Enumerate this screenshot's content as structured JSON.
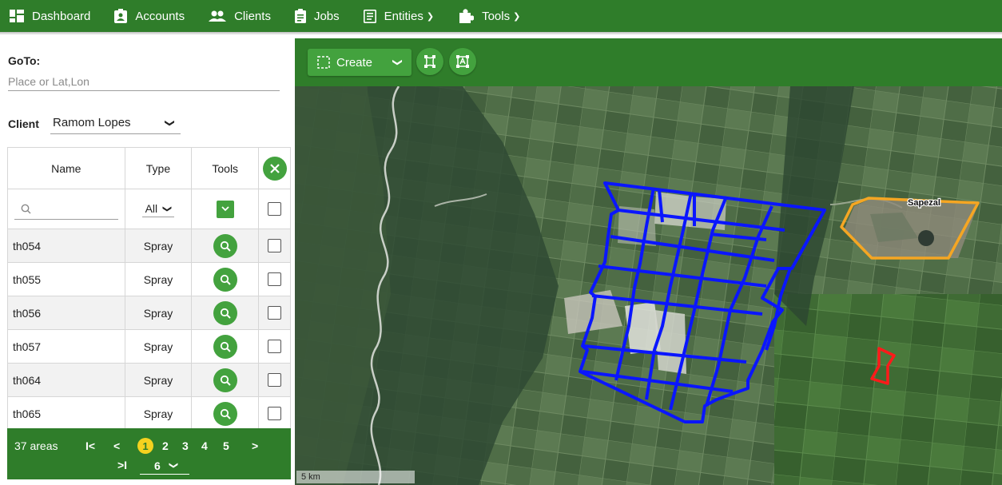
{
  "nav": [
    {
      "label": "Dashboard",
      "icon": "dashboard-icon"
    },
    {
      "label": "Accounts",
      "icon": "account-badge-icon"
    },
    {
      "label": "Clients",
      "icon": "people-icon"
    },
    {
      "label": "Jobs",
      "icon": "clipboard-icon"
    },
    {
      "label": "Entities",
      "icon": "list-icon",
      "dropdown": true
    },
    {
      "label": "Tools",
      "icon": "puzzle-icon",
      "dropdown": true
    }
  ],
  "goto": {
    "label": "GoTo:",
    "placeholder": "Place or Lat,Lon"
  },
  "client": {
    "label": "Client",
    "selected": "Ramom Lopes"
  },
  "table": {
    "headers": {
      "name": "Name",
      "type": "Type",
      "tools": "Tools"
    },
    "type_filter": "All",
    "rows": [
      {
        "name": "th054",
        "type": "Spray"
      },
      {
        "name": "th055",
        "type": "Spray"
      },
      {
        "name": "th056",
        "type": "Spray"
      },
      {
        "name": "th057",
        "type": "Spray"
      },
      {
        "name": "th064",
        "type": "Spray"
      },
      {
        "name": "th065",
        "type": "Spray"
      }
    ]
  },
  "pager": {
    "count_text": "37 areas",
    "first": "I<",
    "prev": "<",
    "current": "1",
    "pages": [
      "2",
      "3",
      "4",
      "5"
    ],
    "next": ">",
    "last": ">I",
    "page_size": "6"
  },
  "map_toolbar": {
    "create_label": "Create"
  },
  "map": {
    "town_label": "Sapezal",
    "scale_label": "5 km",
    "colors": {
      "fields": "#0a16ff",
      "town": "#f5a623",
      "highlight": "#ff1a1a"
    }
  }
}
